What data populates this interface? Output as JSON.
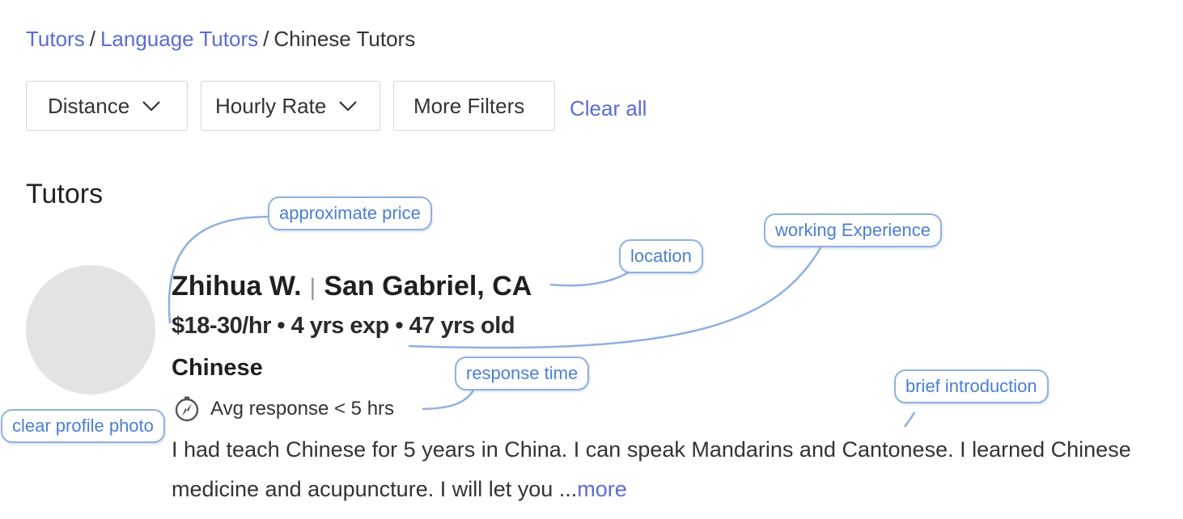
{
  "breadcrumb": {
    "items": [
      "Tutors",
      "Language Tutors"
    ],
    "separator": "/",
    "current": "Chinese Tutors"
  },
  "filters": {
    "distance_label": "Distance",
    "hourly_rate_label": "Hourly Rate",
    "more_filters_label": "More Filters",
    "clear_all_label": "Clear all"
  },
  "section_title": "Tutors",
  "tutor": {
    "name": "Zhihua W.",
    "location": "San Gabriel, CA",
    "stats": "$18-30/hr • 4 yrs exp • 47 yrs old",
    "subject": "Chinese",
    "response": "Avg response < 5 hrs",
    "bio": "I had teach Chinese for 5 years in China. I can speak Mandarins and Cantonese. I learned Chinese medicine and acupuncture. I will let you ...",
    "more_label": "more"
  },
  "annotations": {
    "approximate_price": "approximate price",
    "location": "location",
    "working_experience": "working Experience",
    "response_time": "response time",
    "brief_introduction": "brief introduction",
    "clear_profile_photo": "clear profile photo"
  },
  "colors": {
    "link": "#5b6bd6",
    "annotation_border": "#8fb0e0",
    "annotation_text": "#4a7fd0",
    "avatar": "#e3e3e3"
  }
}
